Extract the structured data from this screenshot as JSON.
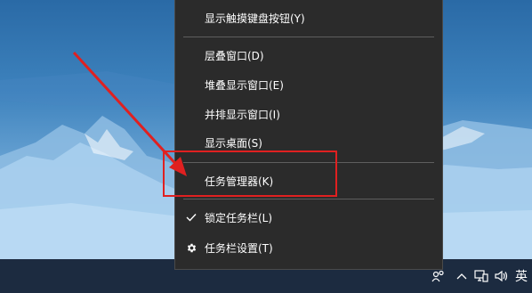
{
  "context_menu": {
    "items": [
      {
        "label": "显示触摸键盘按钮(Y)"
      },
      {
        "label": "层叠窗口(D)"
      },
      {
        "label": "堆叠显示窗口(E)"
      },
      {
        "label": "并排显示窗口(I)"
      },
      {
        "label": "显示桌面(S)"
      },
      {
        "label": "任务管理器(K)"
      },
      {
        "label": "锁定任务栏(L)",
        "checked": true,
        "icon": "check-icon"
      },
      {
        "label": "任务栏设置(T)",
        "icon": "gear-icon"
      }
    ]
  },
  "taskbar": {
    "tray": {
      "icons": [
        "people-icon",
        "chevron-up-icon",
        "network-icon",
        "volume-icon"
      ],
      "ime_label": "英"
    }
  },
  "annotation": {
    "color": "#e02020",
    "icons": [
      "arrow-annotation",
      "highlight-box"
    ]
  }
}
